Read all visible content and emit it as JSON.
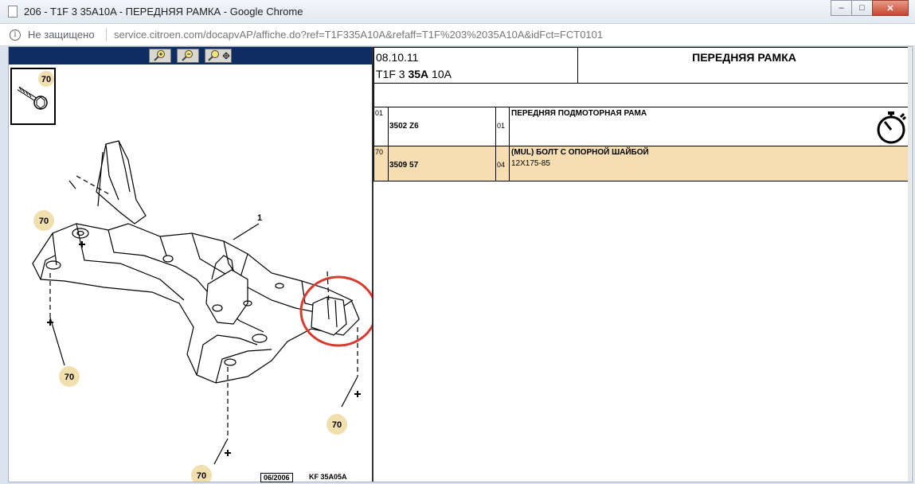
{
  "window": {
    "title": "206 - T1F 3 35A10A - ПЕРЕДНЯЯ РАМКА - Google Chrome",
    "minimize": "–",
    "maximize": "□",
    "close": "✕"
  },
  "address": {
    "security_label": "Не защищено",
    "url_host": "service.citroen.com",
    "url_path": "/docapvAP/affiche.do?ref=T1F335A10A&refaff=T1F%203%2035A10A&idFct=FCT0101"
  },
  "diagram": {
    "toolbar": [
      "zoom-in-icon",
      "zoom-out-icon",
      "zoom-fit-icon"
    ],
    "thumb_label": "70",
    "part_label": "1",
    "callouts": [
      "70",
      "70",
      "70",
      "70",
      "70"
    ],
    "footer_date": "06/2006",
    "footer_code": "KF 35A05A"
  },
  "header": {
    "date": "08.10.11",
    "code_prefix": "T1F 3 ",
    "code_bold": "35A",
    "code_suffix": " 10A",
    "title": "ПЕРЕДНЯЯ РАМКА"
  },
  "parts": [
    {
      "ref": "01",
      "part_number": "3502 Z6",
      "qty": "01",
      "description": "ПЕРЕДНЯЯ ПОДМОТОРНАЯ РАМА",
      "detail": "",
      "icon": "stopwatch-icon"
    },
    {
      "ref": "70",
      "part_number": "3509 57",
      "qty": "04",
      "description": "(MUL) БОЛТ С ОПОРНОЙ ШАЙБОЙ",
      "detail": "12X175-85",
      "highlight": "#f6deb2"
    }
  ],
  "colors": {
    "toolbar": "#0d2d63",
    "callout_fill": "#f2dfae",
    "annotation_circle": "#d83a2e"
  }
}
